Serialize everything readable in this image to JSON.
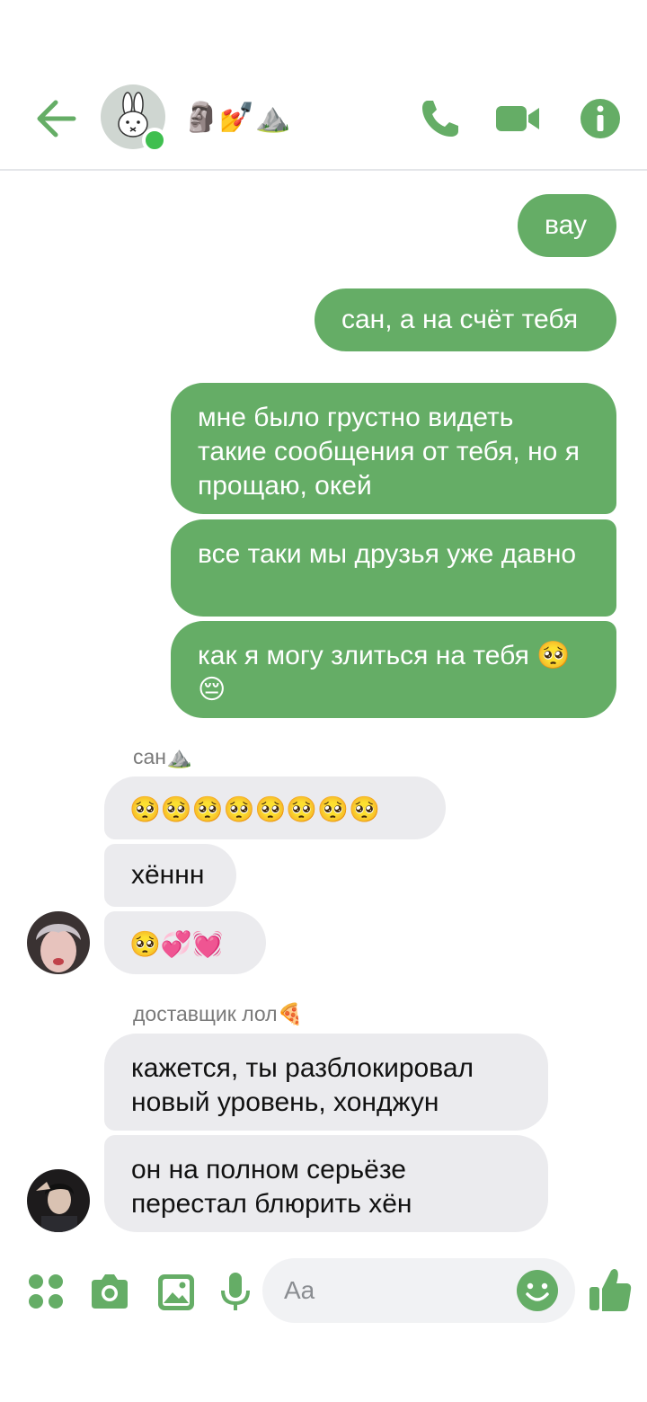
{
  "header": {
    "title_emoji": "🗿💅⛰️"
  },
  "messages_mine": [
    "вау",
    "сан, а на счёт тебя",
    "мне было грустно видеть такие сообщения от тебя, но я прощаю, окей",
    "все таки мы друзья уже давно",
    "как я могу злиться на тебя 🥺😔"
  ],
  "group1": {
    "sender": "сан⛰️",
    "messages": [
      "🥺🥺🥺🥺🥺🥺🥺🥺",
      "хённн",
      "🥺💞💓"
    ]
  },
  "group2": {
    "sender": "доставщик лол🍕",
    "messages": [
      "кажется, ты разблокировал новый уровень, хонджун",
      "он на полном серьёзе перестал блюрить хён"
    ]
  },
  "composer": {
    "placeholder": "Aa"
  },
  "colors": {
    "accent": "#65ad66",
    "bubble_theirs": "#ebebee",
    "online": "#3fbf4f"
  },
  "icons": [
    "back-arrow-icon",
    "phone-icon",
    "video-camera-icon",
    "info-icon",
    "apps-icon",
    "camera-icon",
    "image-icon",
    "microphone-icon",
    "smiley-icon",
    "thumbs-up-icon"
  ]
}
